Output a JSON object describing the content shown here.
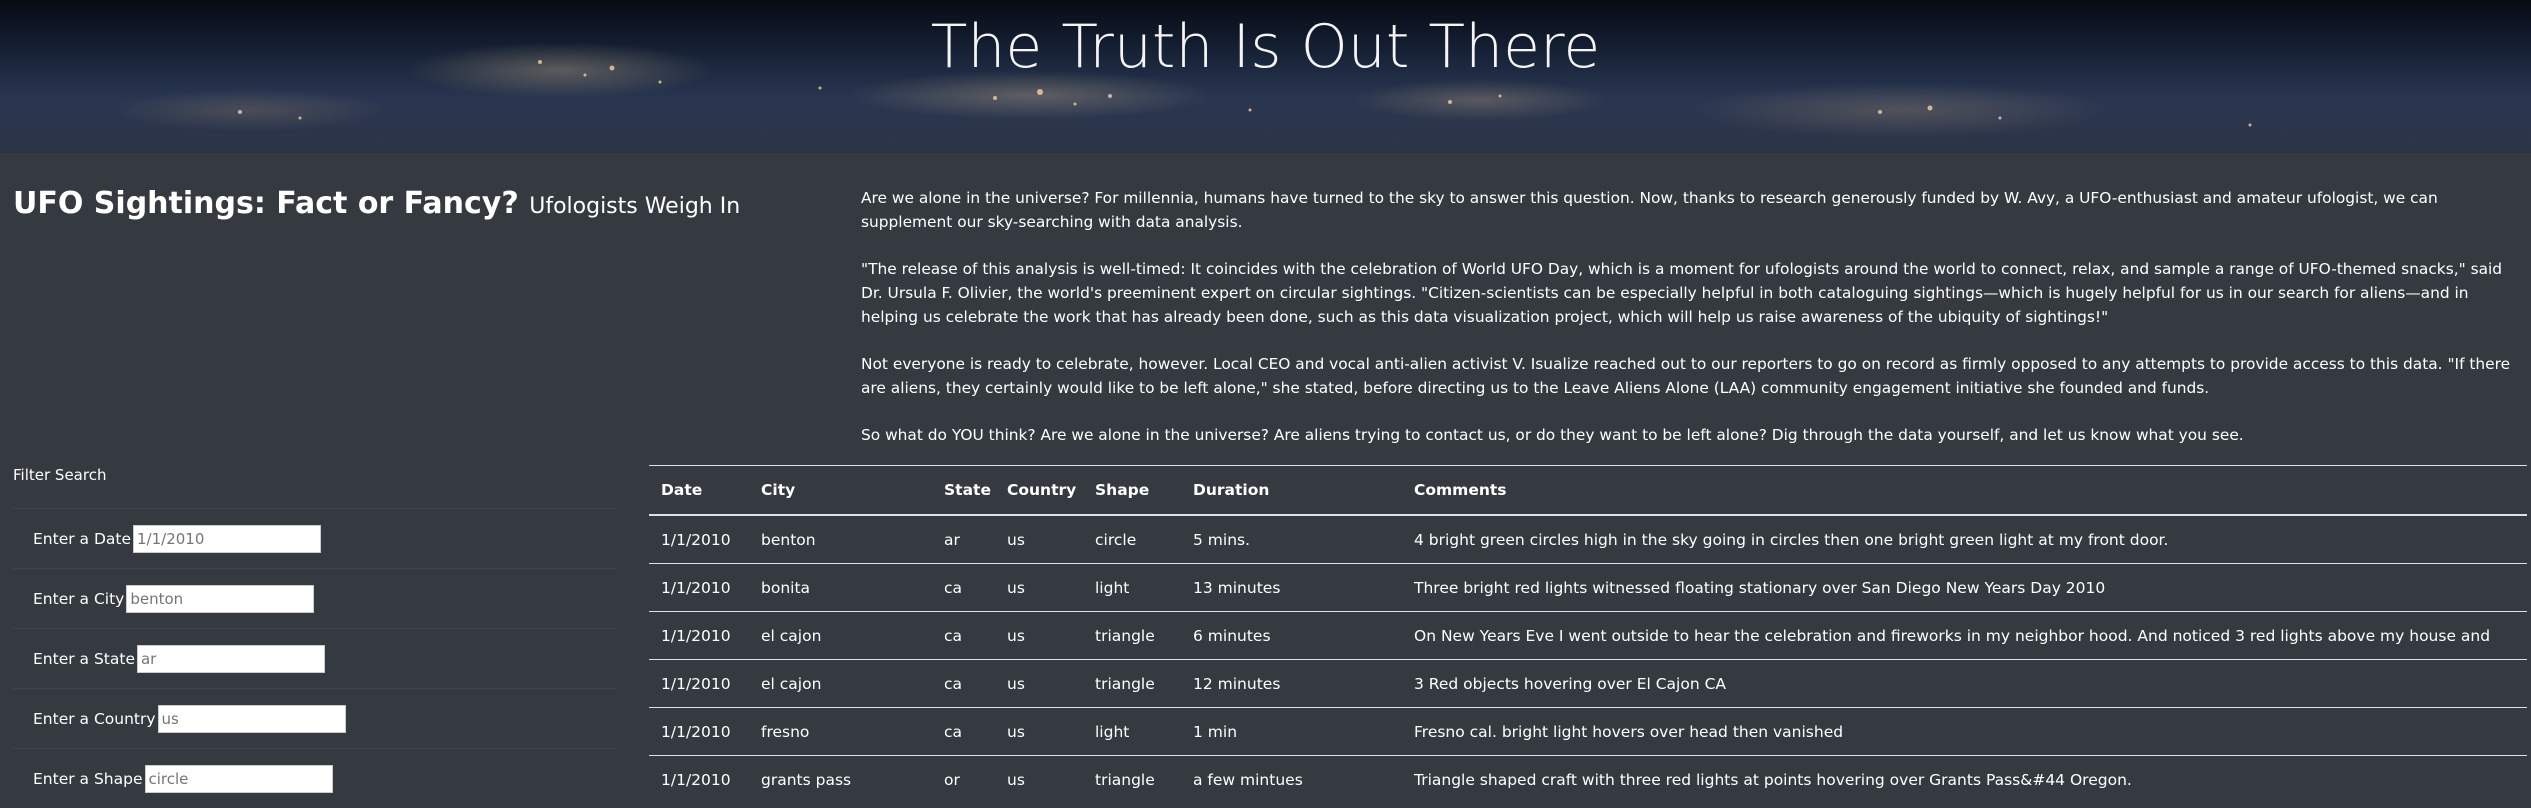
{
  "header": {
    "title": "The Truth Is Out There"
  },
  "intro": {
    "title": "UFO Sightings: Fact or Fancy?",
    "subtitle": "Ufologists Weigh In"
  },
  "article": {
    "paragraphs": [
      "Are we alone in the universe? For millennia, humans have turned to the sky to answer this question. Now, thanks to research generously funded by W. Avy, a UFO-enthusiast and amateur ufologist, we can supplement our sky-searching with data analysis.",
      "\"The release of this analysis is well-timed: It coincides with the celebration of World UFO Day, which is a moment for ufologists around the world to connect, relax, and sample a range of UFO-themed snacks,\" said Dr. Ursula F. Olivier, the world's preeminent expert on circular sightings. \"Citizen-scientists can be especially helpful in both cataloguing sightings—which is hugely helpful for us in our search for aliens—and in helping us celebrate the work that has already been done, such as this data visualization project, which will help us raise awareness of the ubiquity of sightings!\"",
      "Not everyone is ready to celebrate, however. Local CEO and vocal anti-alien activist V. Isualize reached out to our reporters to go on record as firmly opposed to any attempts to provide access to this data. \"If there are aliens, they certainly would like to be left alone,\" she stated, before directing us to the Leave Aliens Alone (LAA) community engagement initiative she founded and funds.",
      "So what do YOU think? Are we alone in the universe? Are aliens trying to contact us, or do they want to be left alone? Dig through the data yourself, and let us know what you see."
    ]
  },
  "filters": {
    "heading": "Filter Search",
    "date": {
      "label": "Enter a Date",
      "placeholder": "1/1/2010"
    },
    "city": {
      "label": "Enter a City",
      "placeholder": "benton"
    },
    "state": {
      "label": "Enter a State",
      "placeholder": "ar"
    },
    "country": {
      "label": "Enter a Country",
      "placeholder": "us"
    },
    "shape": {
      "label": "Enter a Shape",
      "placeholder": "circle"
    }
  },
  "table": {
    "headers": {
      "date": "Date",
      "city": "City",
      "state": "State",
      "country": "Country",
      "shape": "Shape",
      "duration": "Duration",
      "comments": "Comments"
    },
    "rows": [
      {
        "date": "1/1/2010",
        "city": "benton",
        "state": "ar",
        "country": "us",
        "shape": "circle",
        "duration": "5 mins.",
        "comments": "4 bright green circles high in the sky going in circles then one bright green light at my front door."
      },
      {
        "date": "1/1/2010",
        "city": "bonita",
        "state": "ca",
        "country": "us",
        "shape": "light",
        "duration": "13 minutes",
        "comments": "Three bright red lights witnessed floating stationary over San Diego New Years Day 2010"
      },
      {
        "date": "1/1/2010",
        "city": "el cajon",
        "state": "ca",
        "country": "us",
        "shape": "triangle",
        "duration": "6 minutes",
        "comments": "On New Years Eve I went outside to hear the celebration and fireworks in my neighbor hood. And noticed 3 red lights above my house and"
      },
      {
        "date": "1/1/2010",
        "city": "el cajon",
        "state": "ca",
        "country": "us",
        "shape": "triangle",
        "duration": "12 minutes",
        "comments": "3 Red objects hovering over El Cajon CA"
      },
      {
        "date": "1/1/2010",
        "city": "fresno",
        "state": "ca",
        "country": "us",
        "shape": "light",
        "duration": "1 min",
        "comments": "Fresno cal. bright light hovers over head then vanished"
      },
      {
        "date": "1/1/2010",
        "city": "grants pass",
        "state": "or",
        "country": "us",
        "shape": "triangle",
        "duration": "a few mintues",
        "comments": "Triangle shaped craft with three red lights at points hovering over Grants Pass&#44 Oregon."
      }
    ]
  }
}
